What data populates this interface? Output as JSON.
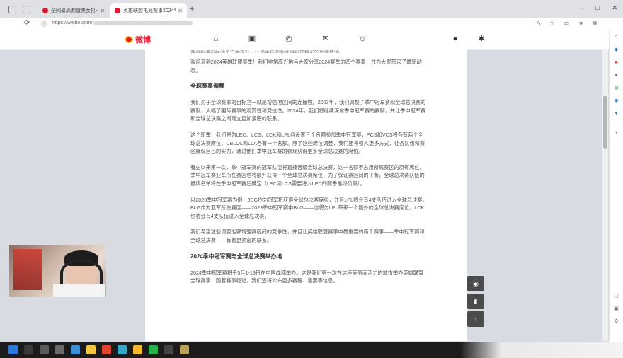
{
  "browser": {
    "tabs": [
      {
        "title": "全网最高颜值美女打卡达人 - 微…",
        "favicon_color": "#e6162d"
      },
      {
        "title": "英雄联盟电竞赛事2024年赛程",
        "favicon_color": "#e6162d"
      }
    ],
    "new_tab": "+",
    "url_prefix": "https://weibo.com/",
    "window_controls": [
      "–",
      "□",
      "✕"
    ]
  },
  "site": {
    "logo_text": "微博",
    "nav_icons": [
      "home-icon",
      "video-icon",
      "discover-icon",
      "message-icon",
      "profile-icon"
    ],
    "right_icons": [
      "notification-icon",
      "settings-icon"
    ]
  },
  "article": {
    "cut_line": "赛事服务与经验多方面提升，让选手与观众获得更加精彩的比赛体验。",
    "intro": "欢迎来到2024英雄联盟赛季！我们非常高兴地与大家分享2024赛季的四个赛事，并为大家带来了最新动态。",
    "sections": [
      {
        "heading": "全球赛事调整",
        "paragraphs": [
          "我们对于全球赛事的目标之一就是增强地区间的连接性。2023年，我们调整了季中冠军赛和全球总决赛的赛制，大幅了国际赛事的观赏性和竞技性。2024年，我们将继续深化季中冠军赛的赛制，并让季中冠军赛和全球总决赛之间建立更加紧密的联系。",
          "这个新季，我们将为LEC、LCS、LCK和LPL各设置三个名额参加季中冠军赛，PCS和VCS将各有两个全球总决赛席位，CBLOL和LLA各有一个名额。除了这些席位调整，我们还将引入更多方式，让各队伍和赛区展现自己的实力，通过他们季中冠军赛的表现获得更多全球总决赛的席位。",
          "有史以来第一次，季中冠军赛的冠军队伍将直接晋级全球总决赛，这一名额不占用所属赛区的原有席位。季中冠军赛亚军所在赛区也将额外获得一个全球总决赛席位，为了保证赛区间的平衡，全球总决赛队伍的最终名单将在季中冠军赛后确定（LEC和LCS需要进入LEC的赛季最终阶段）。",
          "以2023季中冠军赛为例，JDG作为冠军将获得全球总决赛席位，并且LPL将会有4支队伍进入全球总决赛。BLG作为亚军所在赛区——2023季中冠军赛中BLG——也将为LPL带来一个额外的全球总决赛席位，LCK也将会有4支队伍进入全球总决赛。",
          "我们希望这些调整能够增强赛区间的竞争性，并且让英雄联盟赛事中最重要的两个赛事——季中冠军赛和全球总决赛——有着更紧密的联系。"
        ]
      },
      {
        "heading": "2024季中冠军赛与全球总决赛举办地",
        "paragraphs": [
          "2024季中冠军赛将于5月1-19日在中国成都举办。这是我们第一次在这座美丽而活力的城市举办英雄联盟全球赛事，随着赛事临近，我们还将公布更多赛程、售票等信息。"
        ]
      }
    ]
  },
  "float_buttons": [
    "eye-icon",
    "bookmark-icon",
    "back-to-top-icon"
  ],
  "taskbar": {
    "icons": [
      {
        "name": "start-icon",
        "color": "#2f7ad8"
      },
      {
        "name": "search-icon",
        "color": "#3a3a3a"
      },
      {
        "name": "task-view-icon",
        "color": "#5a5a5a"
      },
      {
        "name": "store-icon",
        "color": "#6a6a6a"
      },
      {
        "name": "mail-icon",
        "color": "#3d8fd6"
      },
      {
        "name": "explorer-icon",
        "color": "#f2c744"
      },
      {
        "name": "chrome-icon",
        "color": "#e0452f"
      },
      {
        "name": "edge-icon",
        "color": "#33a8c9"
      },
      {
        "name": "qq-icon",
        "color": "#f5b82e"
      },
      {
        "name": "wechat-icon",
        "color": "#29b24c"
      },
      {
        "name": "obs-icon",
        "color": "#444444"
      },
      {
        "name": "pen-icon",
        "color": "#b8a15a"
      }
    ]
  }
}
